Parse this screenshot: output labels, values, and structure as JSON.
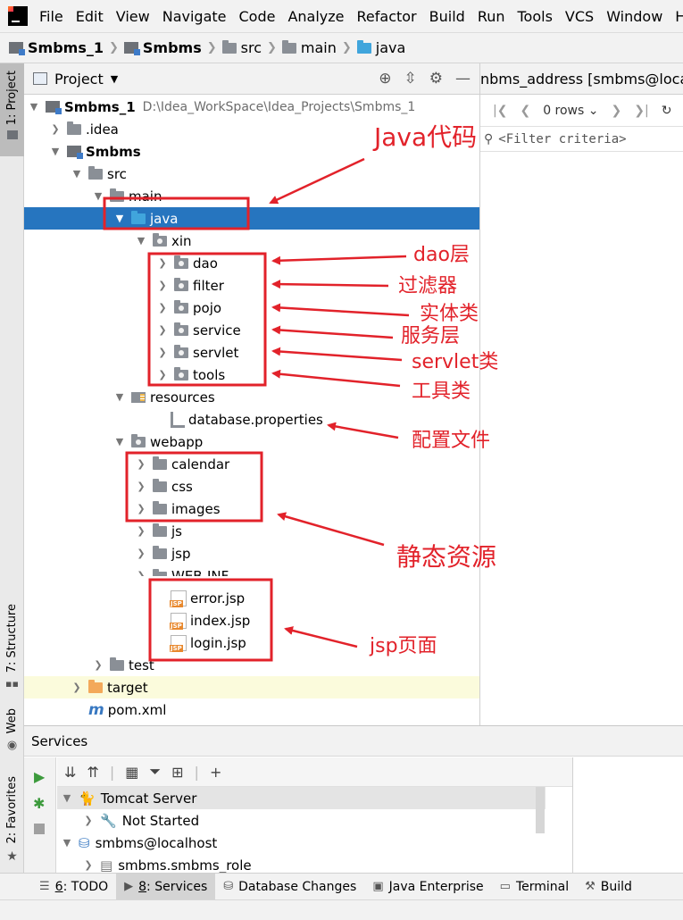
{
  "menu": [
    "File",
    "Edit",
    "View",
    "Navigate",
    "Code",
    "Analyze",
    "Refactor",
    "Build",
    "Run",
    "Tools",
    "VCS",
    "Window",
    "Help"
  ],
  "breadcrumb": [
    "Smbms_1",
    "Smbms",
    "src",
    "main",
    "java"
  ],
  "left_stripe": {
    "project": "1: Project",
    "structure": "7: Structure",
    "web": "Web",
    "favorites": "2: Favorites"
  },
  "project_panel": {
    "title": "Project",
    "root": {
      "name": "Smbms_1",
      "path": "D:\\Idea_WorkSpace\\Idea_Projects\\Smbms_1"
    },
    "tree": [
      ".idea",
      "Smbms",
      "src",
      "main",
      "java",
      "xin",
      "dao",
      "filter",
      "pojo",
      "service",
      "servlet",
      "tools",
      "resources",
      "database.properties",
      "webapp",
      "calendar",
      "css",
      "images",
      "js",
      "jsp",
      "WEB-INF",
      "error.jsp",
      "index.jsp",
      "login.jsp",
      "test",
      "target",
      "pom.xml"
    ]
  },
  "db_panel": {
    "tab": "nbms_address [smbms@localho",
    "rows": "0 rows",
    "filter_placeholder": "<Filter criteria>"
  },
  "services": {
    "title": "Services",
    "tree": [
      "Tomcat Server",
      "Not Started",
      "smbms@localhost",
      "smbms.smbms_role"
    ]
  },
  "bottom_bar": [
    {
      "num": "6",
      "label": ": TODO"
    },
    {
      "num": "8",
      "label": ": Services"
    },
    {
      "num": "",
      "label": "Database Changes"
    },
    {
      "num": "",
      "label": "Java Enterprise"
    },
    {
      "num": "",
      "label": "Terminal"
    },
    {
      "num": "",
      "label": "Build"
    }
  ],
  "annotations": [
    "Java代码",
    "dao层",
    "过滤器",
    "实体类",
    "服务层",
    "servlet类",
    "工具类",
    "配置文件",
    "静态资源",
    "jsp页面"
  ],
  "colors": {
    "annotation": "#e2222a",
    "selection": "#2675bf",
    "folder_blue": "#40a5dc",
    "folder_orange": "#f3a95a"
  }
}
